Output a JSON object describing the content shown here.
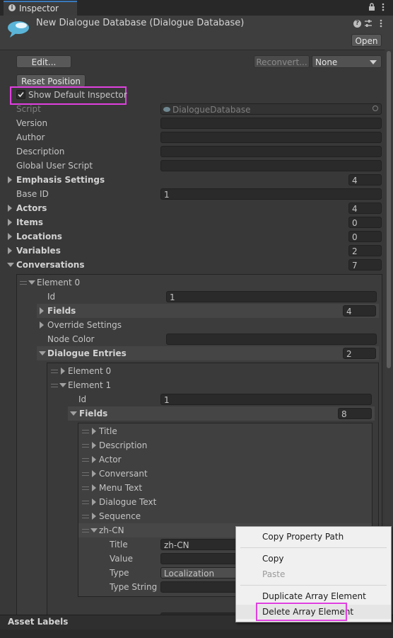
{
  "tab": {
    "title": "Inspector"
  },
  "header": {
    "title": "New Dialogue Database (Dialogue Database)",
    "open_label": "Open"
  },
  "toolbar": {
    "edit_label": "Edit...",
    "reconvert_label": "Reconvert...",
    "none_select": "None"
  },
  "reset_position_label": "Reset Position",
  "show_default_inspector": {
    "label": "Show Default Inspector",
    "checked": true
  },
  "props": {
    "script_label": "Script",
    "script_value": "DialogueDatabase",
    "version_label": "Version",
    "author_label": "Author",
    "description_label": "Description",
    "global_user_script_label": "Global User Script",
    "emphasis_settings_label": "Emphasis Settings",
    "emphasis_settings_count": "4",
    "base_id_label": "Base ID",
    "base_id_value": "1",
    "actors_label": "Actors",
    "actors_count": "4",
    "items_label": "Items",
    "items_count": "0",
    "locations_label": "Locations",
    "locations_count": "0",
    "variables_label": "Variables",
    "variables_count": "2",
    "conversations_label": "Conversations",
    "conversations_count": "7"
  },
  "conv_element0": {
    "label": "Element 0",
    "id_label": "Id",
    "id_value": "1",
    "fields_label": "Fields",
    "fields_count": "4",
    "override_settings_label": "Override Settings",
    "node_color_label": "Node Color",
    "dialogue_entries_label": "Dialogue Entries",
    "dialogue_entries_count": "2"
  },
  "entry0_label": "Element 0",
  "entry1": {
    "label": "Element 1",
    "id_label": "Id",
    "id_value": "1",
    "fields_label": "Fields",
    "fields_count": "8"
  },
  "field_items": [
    "Title",
    "Description",
    "Actor",
    "Conversant",
    "Menu Text",
    "Dialogue Text",
    "Sequence"
  ],
  "zh_cn": {
    "label": "zh-CN",
    "title_label": "Title",
    "title_value": "zh-CN",
    "value_label": "Value",
    "type_label": "Type",
    "type_value": "Localization",
    "type_string_label": "Type String"
  },
  "asset_labels": "Asset Labels",
  "context_menu": {
    "copy_property_path": "Copy Property Path",
    "copy": "Copy",
    "paste": "Paste",
    "duplicate_array_element": "Duplicate Array Element",
    "delete_array_element": "Delete Array Element"
  },
  "colors": {
    "highlight": "#e040e0",
    "background": "#383838",
    "field": "#2a2a2a"
  }
}
